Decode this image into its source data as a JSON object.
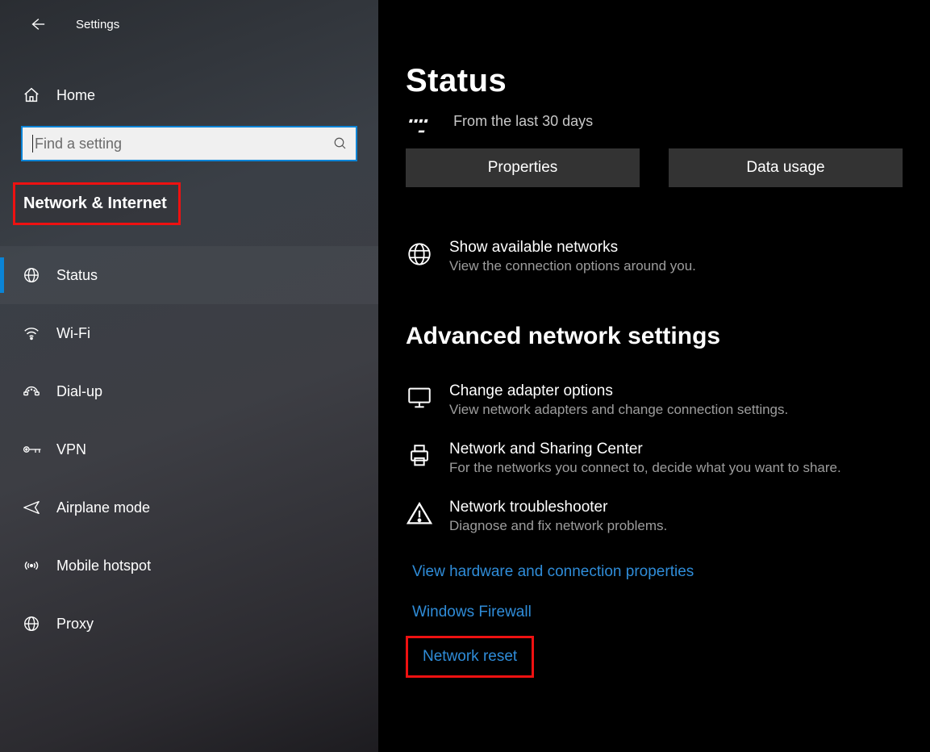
{
  "app": {
    "title": "Settings"
  },
  "sidebar": {
    "home_label": "Home",
    "search_placeholder": "Find a setting",
    "category_label": "Network & Internet",
    "items": [
      {
        "label": "Status"
      },
      {
        "label": "Wi-Fi"
      },
      {
        "label": "Dial-up"
      },
      {
        "label": "VPN"
      },
      {
        "label": "Airplane mode"
      },
      {
        "label": "Mobile hotspot"
      },
      {
        "label": "Proxy"
      }
    ]
  },
  "main": {
    "title": "Status",
    "subtitle": "From the last 30 days",
    "buttons": {
      "properties": "Properties",
      "data_usage": "Data usage"
    },
    "available": {
      "title": "Show available networks",
      "desc": "View the connection options around you."
    },
    "advanced_heading": "Advanced network settings",
    "adapter": {
      "title": "Change adapter options",
      "desc": "View network adapters and change connection settings."
    },
    "sharing": {
      "title": "Network and Sharing Center",
      "desc": "For the networks you connect to, decide what you want to share."
    },
    "troubleshoot": {
      "title": "Network troubleshooter",
      "desc": "Diagnose and fix network problems."
    },
    "links": {
      "hardware": "View hardware and connection properties",
      "firewall": "Windows Firewall",
      "reset": "Network reset"
    }
  }
}
